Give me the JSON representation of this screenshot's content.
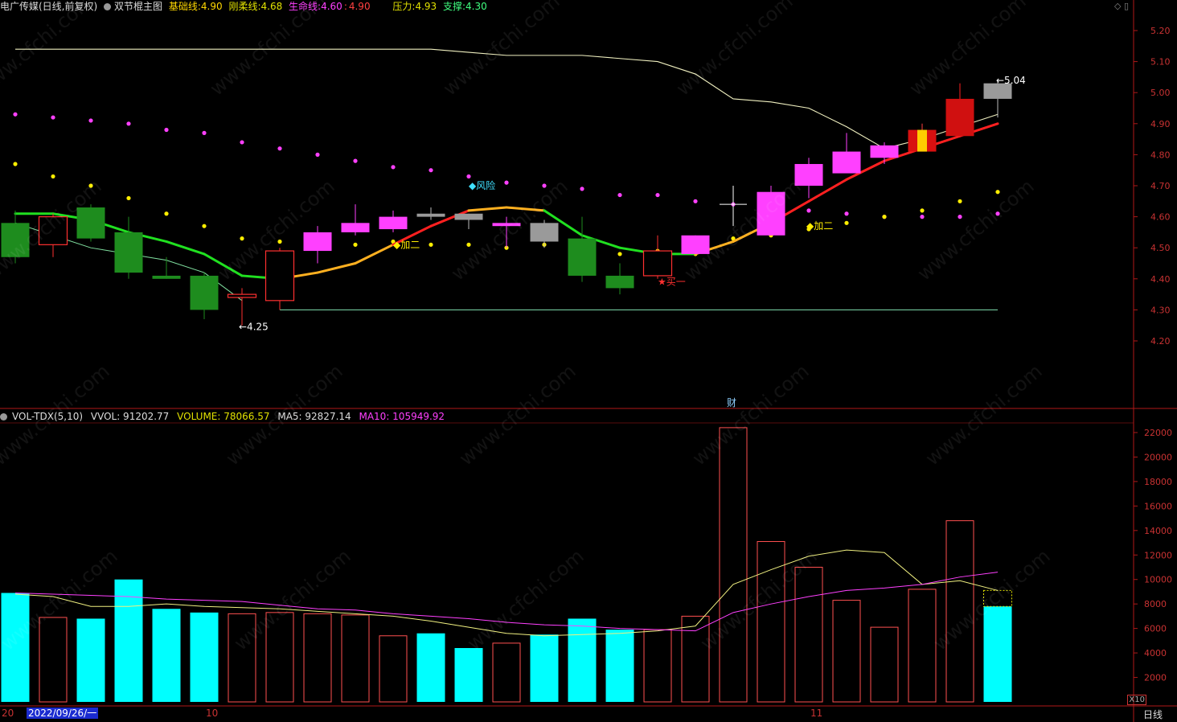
{
  "header": {
    "stock": "电广传媒(日线,前复权)",
    "indicator": "双节棍主图",
    "base_label": "基础线:",
    "base_value": "4.90",
    "gang_label": "刚柔线:",
    "gang_value": "4.68",
    "life_label": "生命线:",
    "life_value": "4.60",
    "life_value2": "4.90",
    "resist_label": "压力:",
    "resist_value": "4.93",
    "support_label": "支撑:",
    "support_value": "4.30"
  },
  "vol_header": {
    "name": "VOL-TDX(5,10)",
    "vvol": "VVOL: 91202.77",
    "volume": "VOLUME: 78066.57",
    "ma5": "MA5: 92827.14",
    "ma10": "MA10: 105949.92"
  },
  "footer": {
    "date_label": "2022/09/26/一",
    "axis_20": "20",
    "axis_10": "10",
    "axis_11": "11",
    "period": "日线",
    "x10": "X10"
  },
  "annotations": {
    "low_label": "←4.25",
    "high_label": "←5.04",
    "risk": "◆风险",
    "add1": "◆加二",
    "add2": "◆加二",
    "buy": "★买一",
    "cai": "财"
  },
  "colors": {
    "up": "#ff3030",
    "down": "#00e5e5",
    "bull_magenta": "#ff40ff",
    "bear_green": "#1e8c1e",
    "grid_border": "#b01818",
    "axis_text": "#c83232"
  },
  "chart_data": [
    {
      "type": "candlestick",
      "title": "双节棍主图",
      "ylim": [
        4.15,
        5.25
      ],
      "yticks": [
        4.2,
        4.3,
        4.4,
        4.5,
        4.6,
        4.7,
        4.8,
        4.9,
        5.0,
        5.1,
        5.2
      ],
      "candles": [
        {
          "o": 4.58,
          "h": 4.62,
          "l": 4.45,
          "c": 4.47,
          "style": "green"
        },
        {
          "o": 4.51,
          "h": 4.61,
          "l": 4.47,
          "c": 4.6,
          "style": "hollow-red"
        },
        {
          "o": 4.63,
          "h": 4.64,
          "l": 4.52,
          "c": 4.53,
          "style": "green"
        },
        {
          "o": 4.55,
          "h": 4.6,
          "l": 4.4,
          "c": 4.42,
          "style": "green"
        },
        {
          "o": 4.41,
          "h": 4.47,
          "l": 4.4,
          "c": 4.4,
          "style": "green"
        },
        {
          "o": 4.41,
          "h": 4.42,
          "l": 4.27,
          "c": 4.3,
          "style": "green"
        },
        {
          "o": 4.34,
          "h": 4.37,
          "l": 4.25,
          "c": 4.35,
          "style": "hollow-red"
        },
        {
          "o": 4.33,
          "h": 4.5,
          "l": 4.3,
          "c": 4.49,
          "style": "hollow-red"
        },
        {
          "o": 4.49,
          "h": 4.57,
          "l": 4.45,
          "c": 4.55,
          "style": "magenta"
        },
        {
          "o": 4.55,
          "h": 4.64,
          "l": 4.54,
          "c": 4.58,
          "style": "magenta"
        },
        {
          "o": 4.56,
          "h": 4.62,
          "l": 4.55,
          "c": 4.6,
          "style": "magenta"
        },
        {
          "o": 4.6,
          "h": 4.63,
          "l": 4.59,
          "c": 4.61,
          "style": "gray"
        },
        {
          "o": 4.59,
          "h": 4.61,
          "l": 4.56,
          "c": 4.61,
          "style": "gray"
        },
        {
          "o": 4.57,
          "h": 4.6,
          "l": 4.5,
          "c": 4.58,
          "style": "magenta"
        },
        {
          "o": 4.58,
          "h": 4.59,
          "l": 4.5,
          "c": 4.52,
          "style": "gray"
        },
        {
          "o": 4.53,
          "h": 4.6,
          "l": 4.39,
          "c": 4.41,
          "style": "green"
        },
        {
          "o": 4.41,
          "h": 4.45,
          "l": 4.35,
          "c": 4.37,
          "style": "green"
        },
        {
          "o": 4.41,
          "h": 4.54,
          "l": 4.4,
          "c": 4.49,
          "style": "hollow-red"
        },
        {
          "o": 4.48,
          "h": 4.54,
          "l": 4.48,
          "c": 4.54,
          "style": "magenta"
        },
        {
          "o": 4.61,
          "h": 4.7,
          "l": 4.57,
          "c": 4.64,
          "style": "cross"
        },
        {
          "o": 4.54,
          "h": 4.7,
          "l": 4.54,
          "c": 4.68,
          "style": "magenta"
        },
        {
          "o": 4.7,
          "h": 4.79,
          "l": 4.66,
          "c": 4.77,
          "style": "magenta"
        },
        {
          "o": 4.74,
          "h": 4.87,
          "l": 4.74,
          "c": 4.81,
          "style": "magenta"
        },
        {
          "o": 4.79,
          "h": 4.84,
          "l": 4.77,
          "c": 4.83,
          "style": "magenta"
        },
        {
          "o": 4.81,
          "h": 4.9,
          "l": 4.81,
          "c": 4.88,
          "style": "gold"
        },
        {
          "o": 4.86,
          "h": 5.03,
          "l": 4.86,
          "c": 4.98,
          "style": "red"
        },
        {
          "o": 4.98,
          "h": 5.04,
          "l": 4.92,
          "c": 5.03,
          "style": "gray"
        }
      ],
      "line_top": [
        5.14,
        5.14,
        5.14,
        5.14,
        5.14,
        5.14,
        5.14,
        5.14,
        5.14,
        5.14,
        5.14,
        5.14,
        5.13,
        5.12,
        5.12,
        5.12,
        5.11,
        5.1,
        5.06,
        4.98,
        4.97,
        4.95,
        4.89,
        4.82,
        4.85,
        4.89,
        4.93
      ],
      "line_base_idx_start": 0,
      "line_base": [
        4.61,
        4.61,
        4.59,
        4.55,
        4.52,
        4.48,
        4.41,
        4.4,
        4.42,
        4.45,
        4.51,
        4.57,
        4.62,
        4.63,
        4.62,
        4.54,
        4.5,
        4.48,
        4.48,
        4.52,
        4.58,
        4.65,
        4.72,
        4.78,
        4.82,
        4.86,
        4.9
      ],
      "line_lower": [
        4.58,
        4.54,
        4.5,
        4.48,
        4.46,
        4.42,
        4.33
      ],
      "support_line": 4.3,
      "dots_magenta": [
        4.93,
        4.92,
        4.91,
        4.9,
        4.88,
        4.87,
        4.84,
        4.82,
        4.8,
        4.78,
        4.76,
        4.75,
        4.73,
        4.71,
        4.7,
        4.69,
        4.67,
        4.67,
        4.65,
        4.64,
        4.62,
        4.62,
        4.61,
        4.6,
        4.6,
        4.6,
        4.61
      ],
      "dots_yellow": [
        4.77,
        4.73,
        4.7,
        4.66,
        4.61,
        4.57,
        4.53,
        4.52,
        4.51,
        4.51,
        4.52,
        4.51,
        4.51,
        4.5,
        4.51,
        4.49,
        4.48,
        4.49,
        4.48,
        4.53,
        4.54,
        4.56,
        4.58,
        4.6,
        4.62,
        4.65,
        4.68
      ]
    },
    {
      "type": "bar",
      "title": "VOL-TDX(5,10)",
      "ylim": [
        0,
        23000
      ],
      "yticks": [
        2000,
        4000,
        6000,
        8000,
        10000,
        12000,
        14000,
        16000,
        18000,
        20000,
        22000
      ],
      "values": [
        8900,
        6900,
        6800,
        10000,
        7600,
        7300,
        7200,
        7300,
        7200,
        7100,
        5400,
        5600,
        4400,
        4800,
        5500,
        6800,
        5900,
        5900,
        7000,
        22400,
        13100,
        11000,
        8300,
        6100,
        9200,
        14800,
        7800
      ],
      "style": [
        "cyan",
        "hollow",
        "cyan",
        "cyan",
        "cyan",
        "cyan",
        "hollow",
        "hollow",
        "hollow",
        "hollow",
        "hollow",
        "cyan",
        "cyan",
        "hollow",
        "cyan",
        "cyan",
        "cyan",
        "hollow",
        "hollow",
        "hollow",
        "hollow",
        "hollow",
        "hollow",
        "hollow",
        "hollow",
        "hollow",
        "cyan"
      ],
      "ma5": [
        8800,
        8600,
        7800,
        7800,
        8000,
        7800,
        7700,
        7600,
        7400,
        7200,
        7000,
        6600,
        6100,
        5600,
        5400,
        5500,
        5600,
        5800,
        6200,
        9600,
        10800,
        11900,
        12400,
        12200,
        9600,
        9900,
        9100
      ],
      "ma10": [
        8900,
        8800,
        8700,
        8600,
        8400,
        8300,
        8200,
        7900,
        7600,
        7500,
        7200,
        7000,
        6800,
        6500,
        6300,
        6200,
        6000,
        5900,
        5800,
        7300,
        8000,
        8600,
        9100,
        9300,
        9600,
        10200,
        10600
      ]
    }
  ]
}
